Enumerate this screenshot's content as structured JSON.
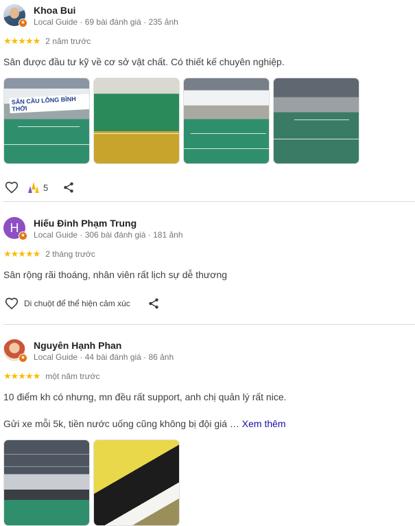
{
  "reviews": [
    {
      "name": "Khoa Bui",
      "meta": "Local Guide · 69 bài đánh giá · 235 ảnh",
      "stars": "★★★★★",
      "date": "2 năm trước",
      "text": "Sân được đầu tư kỹ về cơ sở vật chất. Có thiết kế chuyên nghiệp.",
      "photo_sign": "SÂN CẦU LÔNG BÌNH THỚI",
      "like_count": "5"
    },
    {
      "name": "Hiếu Đinh Phạm Trung",
      "avatar_letter": "H",
      "meta": "Local Guide · 306 bài đánh giá · 181 ảnh",
      "stars": "★★★★★",
      "date": "2 tháng trước",
      "text": "Sân rộng rãi thoáng, nhân viên rất lịch sự dễ thương",
      "reaction_hint": "Di chuột để thể hiện cảm xúc"
    },
    {
      "name": "Nguyên Hạnh Phan",
      "meta": "Local Guide · 44 bài đánh giá · 86 ảnh",
      "stars": "★★★★★",
      "date": "một năm trước",
      "text": "10 điểm kh có nhưng, mn đều rất support, anh chị quản lý rất nice.",
      "text2": "Gửi xe mỗi 5k, tiền nước uống cũng không bị đội giá …",
      "see_more": "Xem thêm"
    }
  ],
  "icons": {
    "like": "heart-outline-icon",
    "reaction": "celebrate-icon",
    "share": "share-icon",
    "local_guide": "local-guide-badge-icon"
  },
  "colors": {
    "stars": "#fbbc04",
    "link": "#1a0dab",
    "divider": "#dadce0",
    "guide_badge": "#e8710a"
  }
}
